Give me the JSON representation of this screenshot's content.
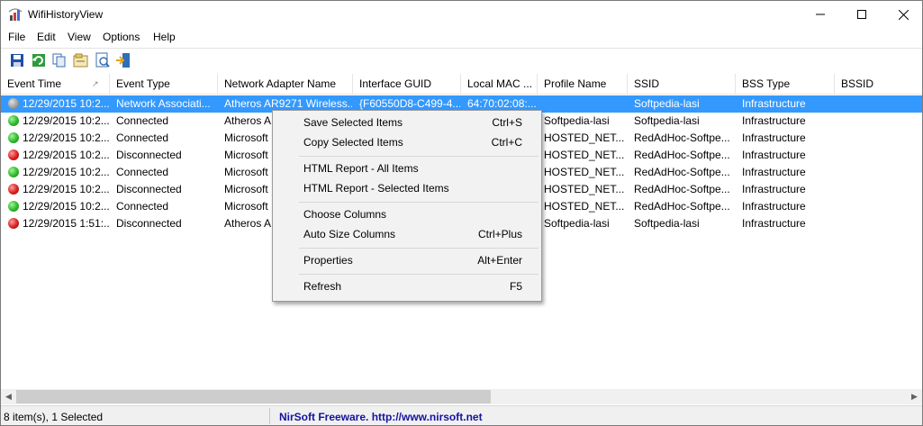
{
  "window": {
    "title": "WifiHistoryView"
  },
  "menubar": {
    "items": [
      "File",
      "Edit",
      "View",
      "Options",
      "Help"
    ]
  },
  "toolbar": {
    "icons": [
      "save-icon",
      "refresh-icon",
      "copy-icon",
      "properties-icon",
      "html-report-icon",
      "exit-icon"
    ]
  },
  "columns": [
    "Event Time",
    "Event Type",
    "Network Adapter Name",
    "Interface GUID",
    "Local MAC ...",
    "Profile Name",
    "SSID",
    "BSS Type",
    "BSSID"
  ],
  "rows": [
    {
      "status": "gray",
      "event_time": "12/29/2015 10:2...",
      "event_type": "Network Associati...",
      "adapter": "Atheros AR9271 Wireless...",
      "guid": "{F60550D8-C499-4...",
      "mac": "64:70:02:08:...",
      "profile": "",
      "ssid": "Softpedia-lasi",
      "bss_type": "Infrastructure"
    },
    {
      "status": "green",
      "event_time": "12/29/2015 10:2...",
      "event_type": "Connected",
      "adapter": "Atheros A",
      "guid": "",
      "mac": "",
      "profile": "Softpedia-lasi",
      "ssid": "Softpedia-lasi",
      "bss_type": "Infrastructure"
    },
    {
      "status": "green",
      "event_time": "12/29/2015 10:2...",
      "event_type": "Connected",
      "adapter": "Microsoft",
      "guid": "",
      "mac": "",
      "profile": "HOSTED_NET...",
      "ssid": "RedAdHoc-Softpe...",
      "bss_type": "Infrastructure"
    },
    {
      "status": "red",
      "event_time": "12/29/2015 10:2...",
      "event_type": "Disconnected",
      "adapter": "Microsoft",
      "guid": "",
      "mac": "",
      "profile": "HOSTED_NET...",
      "ssid": "RedAdHoc-Softpe...",
      "bss_type": "Infrastructure"
    },
    {
      "status": "green",
      "event_time": "12/29/2015 10:2...",
      "event_type": "Connected",
      "adapter": "Microsoft",
      "guid": "",
      "mac": "",
      "profile": "HOSTED_NET...",
      "ssid": "RedAdHoc-Softpe...",
      "bss_type": "Infrastructure"
    },
    {
      "status": "red",
      "event_time": "12/29/2015 10:2...",
      "event_type": "Disconnected",
      "adapter": "Microsoft",
      "guid": "",
      "mac": "",
      "profile": "HOSTED_NET...",
      "ssid": "RedAdHoc-Softpe...",
      "bss_type": "Infrastructure"
    },
    {
      "status": "green",
      "event_time": "12/29/2015 10:2...",
      "event_type": "Connected",
      "adapter": "Microsoft",
      "guid": "",
      "mac": "",
      "profile": "HOSTED_NET...",
      "ssid": "RedAdHoc-Softpe...",
      "bss_type": "Infrastructure"
    },
    {
      "status": "red",
      "event_time": "12/29/2015 1:51:...",
      "event_type": "Disconnected",
      "adapter": "Atheros A",
      "guid": "",
      "mac": "",
      "profile": "Softpedia-lasi",
      "ssid": "Softpedia-lasi",
      "bss_type": "Infrastructure"
    }
  ],
  "context_menu": {
    "items": [
      {
        "label": "Save Selected Items",
        "shortcut": "Ctrl+S"
      },
      {
        "label": "Copy Selected Items",
        "shortcut": "Ctrl+C"
      },
      {
        "label": "HTML Report - All Items",
        "shortcut": ""
      },
      {
        "label": "HTML Report - Selected Items",
        "shortcut": ""
      },
      {
        "label": "Choose Columns",
        "shortcut": ""
      },
      {
        "label": "Auto Size Columns",
        "shortcut": "Ctrl+Plus"
      },
      {
        "label": "Properties",
        "shortcut": "Alt+Enter"
      },
      {
        "label": "Refresh",
        "shortcut": "F5"
      }
    ]
  },
  "statusbar": {
    "left": "8 item(s), 1 Selected",
    "right": "NirSoft Freeware.  http://www.nirsoft.net"
  },
  "colors": {
    "selection": "#3399ff",
    "status_link": "#1414a0"
  }
}
